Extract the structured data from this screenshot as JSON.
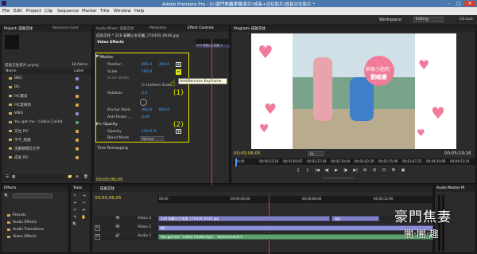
{
  "titlebar": {
    "title": "Adobe Premiere Pro - D:\\豪門焦糖拿鐵\\影片\\成長+交往影片\\成長交往影片 *",
    "min": "–",
    "max": "▢",
    "close": "✕"
  },
  "menu": [
    "File",
    "Edit",
    "Project",
    "Clip",
    "Sequence",
    "Marker",
    "Title",
    "Window",
    "Help"
  ],
  "workspace": {
    "label": "Workspace:",
    "value": "Editing",
    "cs_live": "CS Live"
  },
  "project": {
    "tabs": [
      "Project: 成長交往",
      "Resource Cent"
    ],
    "file": "成長交往影片.prproj",
    "items_count": "18 Items",
    "header_name": "Name",
    "header_label": "Label",
    "items": [
      {
        "name": "BBG",
        "color": "#8f8fd8"
      },
      {
        "name": "BG",
        "color": "#8f8fd8"
      },
      {
        "name": "PIC寶貝",
        "color": "#d6a64a"
      },
      {
        "name": "PIC愛哪哥",
        "color": "#d6a64a"
      },
      {
        "name": "WBG",
        "color": "#8f8fd8"
      },
      {
        "name": "You got me - Colbie Caillat",
        "color": "#5fa06f"
      },
      {
        "name": "交往 PIC",
        "color": "#d6a64a"
      },
      {
        "name": "字卡_短版",
        "color": "#d6a64a"
      },
      {
        "name": "洗髮精標誌文字",
        "color": "#d6a64a"
      },
      {
        "name": "成長 PIC",
        "color": "#d6a64a"
      }
    ]
  },
  "effect_controls": {
    "tabs": [
      "Audio Mixer: 成長交往",
      "Metadata",
      "Effect Controls"
    ],
    "header_seq": "成長交往 * 228 安麗公主花園_170429_0036.jpg",
    "video_effects": "Video Effects",
    "motion": "Motion",
    "position_label": "Position",
    "position_x": "965.0",
    "position_y": "269.0",
    "scale_label": "Scale",
    "scale_value": "160.0",
    "scale_width_label": "Scale Width",
    "uniform_scale": "Uniform Scale",
    "rotation_label": "Rotation",
    "rotation_value": "0.0",
    "anchor_label": "Anchor Point",
    "anchor_x": "960.0",
    "anchor_y": "640.0",
    "antiflicker_label": "Anti-flicker ...",
    "antiflicker_value": "0.00",
    "opacity_group": "Opacity",
    "opacity_label": "Opacity",
    "opacity_value": "100.0 %",
    "blend_label": "Blend Mode",
    "blend_value": "Normal",
    "time_remap": "Time Remapping",
    "tooltip": "Add/Remove Keyframe",
    "annot1": "(1)",
    "annot2": "(2)",
    "timecode": "00;00;06;05",
    "clip_name": "228 安麗公主花園_1"
  },
  "program": {
    "tab": "Program: 成長交往",
    "timecode_left": "00;00;06;05",
    "fit": "Fit",
    "timecode_right": "00;05;19;16",
    "ruler": [
      "00;00",
      "00;00;32;16",
      "00;01;05;02",
      "00;01;37;18",
      "00;02;10;04",
      "00;02;42;20",
      "00;03;15;06",
      "00;03;47;22",
      "00;04;20;08",
      "00;04;52;24"
    ],
    "overlay_text_1": "帥氣小肥肉",
    "overlay_text_2": "劉峻豪",
    "hearts_color": "#f07c9a",
    "transport": [
      "{",
      "}",
      "|◀",
      "◀|",
      "▶",
      "|▶",
      "▶|",
      "⊞",
      "⊟",
      "⊡",
      "⌘",
      "▣"
    ]
  },
  "effects": {
    "tab": "Effects",
    "items": [
      "Presets",
      "Audio Effects",
      "Audio Transitions",
      "Video Effects"
    ]
  },
  "tools": {
    "tab": "Tools",
    "icons": [
      "↖",
      "⇥",
      "⇔",
      "⇿",
      "✂",
      "⇹",
      "✎",
      "✋",
      "🔍"
    ]
  },
  "timeline": {
    "tab": "成長交往",
    "timecode": "00;00;06;05",
    "ruler": [
      "00;00",
      "00;00;04;00",
      "00;00;08;00",
      "00;00;12;00"
    ],
    "tracks": [
      "Video 2",
      "Video 1",
      "Audio 1"
    ],
    "v2_clip": "228 安麗公主花園_170429_0035.jpg",
    "v2_clip2": ".jpg",
    "v1_clip": "BG",
    "a1_clip": "You got me - Colbie Caillat.mp3",
    "a1_level": "Volume:Level ▾"
  },
  "audio_master": {
    "tab": "Audio Master M"
  },
  "watermark": {
    "line1": "豪門焦妻",
    "line2": "闇‧闇‧趣"
  }
}
